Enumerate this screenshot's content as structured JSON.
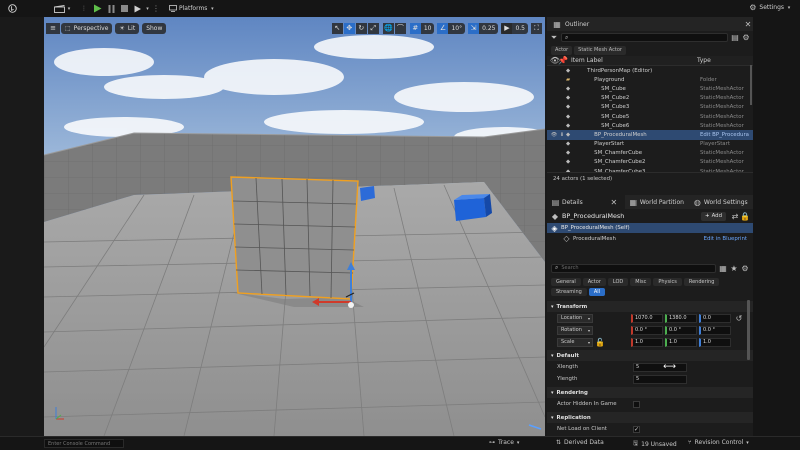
{
  "toolbar": {
    "platforms_label": "Platforms",
    "settings_label": "Settings"
  },
  "viewport_toolbar": {
    "perspective_label": "Perspective",
    "lit_label": "Lit",
    "show_label": "Show",
    "grid_snap_value": "10",
    "rotation_snap_value": "10°",
    "scale_snap_value": "0.25",
    "camera_speed_value": "0.5"
  },
  "outliner": {
    "tab_label": "Outliner",
    "filter_chips": [
      "Actor",
      "Static Mesh Actor"
    ],
    "col_item_label": "Item Label",
    "col_type": "Type",
    "rows": [
      {
        "label": "ThirdPersonMap (Editor)",
        "type": "",
        "indent": 0
      },
      {
        "label": "Playground",
        "type": "Folder",
        "indent": 1
      },
      {
        "label": "SM_Cube",
        "type": "StaticMeshActor",
        "indent": 2
      },
      {
        "label": "SM_Cube2",
        "type": "StaticMeshActor",
        "indent": 2
      },
      {
        "label": "SM_Cube3",
        "type": "StaticMeshActor",
        "indent": 2
      },
      {
        "label": "SM_Cube5",
        "type": "StaticMeshActor",
        "indent": 2
      },
      {
        "label": "SM_Cube6",
        "type": "StaticMeshActor",
        "indent": 2
      },
      {
        "label": "BP_ProceduralMesh",
        "type": "Edit BP_Procedura",
        "indent": 1,
        "selected": true
      },
      {
        "label": "PlayerStart",
        "type": "PlayerStart",
        "indent": 1
      },
      {
        "label": "SM_ChamferCube",
        "type": "StaticMeshActor",
        "indent": 1
      },
      {
        "label": "SM_ChamferCube2",
        "type": "StaticMeshActor",
        "indent": 1
      },
      {
        "label": "SM_ChamferCube3",
        "type": "StaticMeshActor",
        "indent": 1
      }
    ],
    "footer": "24 actors (1 selected)"
  },
  "details": {
    "tab_label": "Details",
    "tab_world_partition": "World Partition",
    "tab_world_settings": "World Settings",
    "actor_name": "BP_ProceduralMesh",
    "add_label": "Add",
    "self_label": "BP_ProceduralMesh (Self)",
    "component_label": "ProceduralMesh",
    "edit_in_blueprint": "Edit in Blueprint",
    "search_placeholder": "Search",
    "categories": [
      "General",
      "Actor",
      "LOD",
      "Misc",
      "Physics",
      "Rendering",
      "Streaming",
      "All"
    ],
    "transform_label": "Transform",
    "location_label": "Location",
    "location": [
      "1070.0",
      "1380.0",
      "0.0"
    ],
    "rotation_label": "Rotation",
    "rotation": [
      "0.0 °",
      "0.0 °",
      "0.0 °"
    ],
    "scale_label": "Scale",
    "scale": [
      "1.0",
      "1.0",
      "1.0"
    ],
    "default_label": "Default",
    "xlength_label": "Xlength",
    "xlength_value": "5",
    "ylength_label": "Ylength",
    "ylength_value": "5",
    "rendering_label": "Rendering",
    "hidden_label": "Actor Hidden In Game",
    "replication_label": "Replication",
    "net_load_label": "Net Load on Client"
  },
  "statusbar": {
    "console_placeholder": "Enter Console Command",
    "trace_label": "Trace",
    "derived_data_label": "Derived Data",
    "unsaved_label": "19 Unsaved",
    "revision_label": "Revision Control"
  }
}
